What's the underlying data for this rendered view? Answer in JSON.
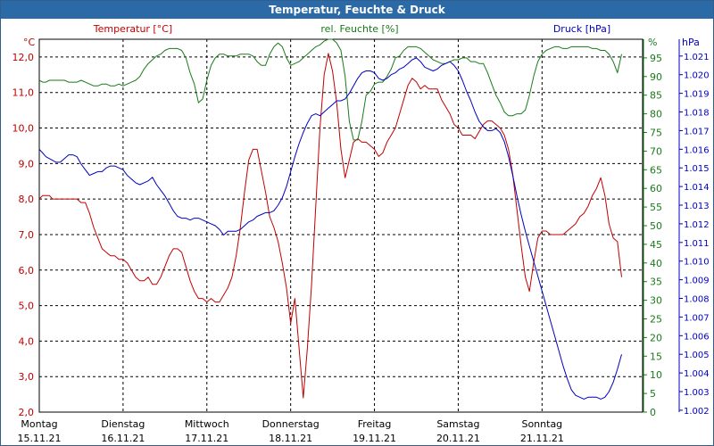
{
  "title": "Temperatur, Feuchte & Druck",
  "chart_data": {
    "type": "line",
    "x_unit": "day",
    "x": [
      0.0,
      0.04,
      0.08,
      0.12,
      0.16,
      0.2,
      0.25,
      0.3,
      0.35,
      0.4,
      0.45,
      0.5,
      0.55,
      0.6,
      0.65,
      0.7,
      0.75,
      0.8,
      0.85,
      0.9,
      0.95,
      1.0,
      1.05,
      1.1,
      1.15,
      1.2,
      1.25,
      1.3,
      1.35,
      1.4,
      1.45,
      1.5,
      1.55,
      1.6,
      1.65,
      1.7,
      1.75,
      1.8,
      1.85,
      1.9,
      1.95,
      2.0,
      2.05,
      2.1,
      2.15,
      2.2,
      2.25,
      2.3,
      2.35,
      2.4,
      2.45,
      2.5,
      2.55,
      2.6,
      2.65,
      2.7,
      2.75,
      2.8,
      2.85,
      2.9,
      2.95,
      3.0,
      3.05,
      3.1,
      3.15,
      3.2,
      3.25,
      3.3,
      3.35,
      3.4,
      3.45,
      3.5,
      3.55,
      3.6,
      3.65,
      3.7,
      3.75,
      3.8,
      3.85,
      3.9,
      3.95,
      4.0,
      4.05,
      4.1,
      4.15,
      4.2,
      4.25,
      4.3,
      4.35,
      4.4,
      4.45,
      4.5,
      4.55,
      4.6,
      4.65,
      4.7,
      4.75,
      4.8,
      4.85,
      4.9,
      4.95,
      5.0,
      5.05,
      5.1,
      5.15,
      5.2,
      5.25,
      5.3,
      5.35,
      5.4,
      5.45,
      5.5,
      5.55,
      5.6,
      5.65,
      5.7,
      5.75,
      5.8,
      5.85,
      5.9,
      5.95,
      6.0,
      6.05,
      6.1,
      6.15,
      6.2,
      6.25,
      6.3,
      6.35,
      6.4,
      6.45,
      6.5,
      6.55,
      6.6,
      6.65,
      6.7,
      6.75,
      6.8,
      6.85,
      6.9,
      6.95
    ],
    "x_ticks": [
      {
        "day": 0,
        "label": "Montag",
        "date": "15.11.21"
      },
      {
        "day": 1,
        "label": "Dienstag",
        "date": "16.11.21"
      },
      {
        "day": 2,
        "label": "Mittwoch",
        "date": "17.11.21"
      },
      {
        "day": 3,
        "label": "Donnerstag",
        "date": "18.11.21"
      },
      {
        "day": 4,
        "label": "Freitag",
        "date": "19.11.21"
      },
      {
        "day": 5,
        "label": "Samstag",
        "date": "20.11.21"
      },
      {
        "day": 6,
        "label": "Sonntag",
        "date": "21.11.21"
      }
    ],
    "xlim": [
      0,
      7.2
    ],
    "grid": true,
    "axes": [
      {
        "id": "temp",
        "label": "Temperatur [°C]",
        "unit": "°C",
        "color": "#c00000",
        "side": "left",
        "ylim": [
          2.0,
          12.5
        ],
        "ticks": [
          "2,0",
          "3,0",
          "4,0",
          "5,0",
          "6,0",
          "7,0",
          "8,0",
          "9,0",
          "10,0",
          "11,0",
          "12,0"
        ],
        "tick_start": 2,
        "tick_step": 1
      },
      {
        "id": "hum",
        "label": "rel. Feuchte [%]",
        "unit": "%",
        "color": "#1a7a1a",
        "side": "right",
        "ylim": [
          0,
          100
        ],
        "ticks": [
          "0",
          "5",
          "10",
          "15",
          "20",
          "25",
          "30",
          "35",
          "40",
          "45",
          "50",
          "55",
          "60",
          "65",
          "70",
          "75",
          "80",
          "85",
          "90",
          "95"
        ],
        "tick_start": 0,
        "tick_step": 5
      },
      {
        "id": "press",
        "label": "Druck [hPa]",
        "unit": "hPa",
        "color": "#0000c0",
        "side": "right",
        "ylim": [
          1001.9,
          1021.9
        ],
        "ticks": [
          "1.002",
          "1.003",
          "1.004",
          "1.005",
          "1.006",
          "1.007",
          "1.008",
          "1.009",
          "1.010",
          "1.011",
          "1.012",
          "1.013",
          "1.014",
          "1.015",
          "1.016",
          "1.017",
          "1.018",
          "1.019",
          "1.020",
          "1.021"
        ],
        "tick_start": 1002,
        "tick_step": 1
      }
    ],
    "series": [
      {
        "axis": "temp",
        "color": "#c00000",
        "values": [
          8.0,
          8.1,
          8.1,
          8.1,
          8.0,
          8.0,
          8.0,
          8.0,
          8.0,
          8.0,
          8.0,
          7.9,
          7.9,
          7.6,
          7.2,
          6.9,
          6.6,
          6.5,
          6.4,
          6.4,
          6.3,
          6.3,
          6.2,
          6.0,
          5.8,
          5.7,
          5.7,
          5.8,
          5.6,
          5.6,
          5.8,
          6.1,
          6.4,
          6.6,
          6.6,
          6.5,
          6.1,
          5.7,
          5.4,
          5.2,
          5.2,
          5.1,
          5.2,
          5.1,
          5.1,
          5.3,
          5.5,
          5.8,
          6.4,
          7.2,
          8.2,
          9.1,
          9.4,
          9.4,
          8.8,
          8.2,
          7.5,
          7.2,
          6.8,
          6.2,
          5.5,
          4.5,
          5.2,
          3.8,
          2.4,
          3.8,
          5.6,
          7.8,
          10.0,
          11.5,
          12.1,
          11.6,
          10.7,
          9.4,
          8.6,
          9.1,
          9.6,
          9.7,
          9.6,
          9.6,
          9.5,
          9.4,
          9.2,
          9.3,
          9.6,
          9.8,
          10.0,
          10.4,
          10.8,
          11.2,
          11.4,
          11.3,
          11.1,
          11.2,
          11.1,
          11.1,
          11.1,
          10.8,
          10.6,
          10.4,
          10.1,
          10.0,
          9.8,
          9.8,
          9.8,
          9.7,
          9.9,
          10.1,
          10.2,
          10.2,
          10.1,
          10.0,
          9.8,
          9.4,
          8.7,
          7.7,
          6.7,
          5.8,
          5.4,
          6.2,
          6.9,
          7.1,
          7.1,
          7.0,
          7.0,
          7.0,
          7.0,
          7.1,
          7.2,
          7.3,
          7.5,
          7.6,
          7.8,
          8.1,
          8.3,
          8.6,
          8.1,
          7.3,
          6.9,
          6.8,
          5.8,
          4.7,
          3.9
        ]
      },
      {
        "axis": "hum",
        "color": "#1a7a1a",
        "values": [
          89,
          88.5,
          88.5,
          89,
          89,
          89,
          89,
          89,
          88.5,
          88.5,
          88.5,
          89,
          88.5,
          88,
          87.5,
          87.5,
          88,
          88,
          87.5,
          87.5,
          88,
          87.5,
          88,
          88.5,
          89,
          90,
          92,
          93.5,
          94.5,
          95.5,
          96,
          97,
          97.5,
          97.5,
          97.5,
          97,
          95,
          91,
          88,
          83,
          84,
          89,
          93,
          95,
          96,
          96,
          95.5,
          95.5,
          95.5,
          96,
          96,
          96,
          95.5,
          94,
          93,
          93,
          96,
          98,
          99,
          98,
          95,
          93,
          93.5,
          94,
          95,
          96,
          97,
          98,
          98.5,
          99.5,
          100,
          100,
          99,
          97,
          90,
          78,
          73,
          73,
          78,
          85,
          86,
          88,
          88.5,
          88.5,
          90,
          92,
          95,
          95.5,
          97,
          98,
          98,
          98,
          97.5,
          96.5,
          95.5,
          94.5,
          94,
          93.5,
          93.5,
          94,
          94.5,
          94.5,
          95,
          95,
          94,
          94,
          93.5,
          93.5,
          91,
          88,
          85,
          83,
          80.5,
          79.5,
          79.5,
          80,
          80,
          81,
          85,
          90,
          94,
          96,
          97,
          97.5,
          98,
          98,
          97.5,
          97.5,
          98,
          98,
          98,
          98,
          98,
          97.5,
          97.5,
          97,
          97,
          96,
          94,
          91,
          96,
          98,
          99
        ]
      },
      {
        "axis": "press",
        "color": "#0000c0",
        "values": [
          1016.0,
          1015.8,
          1015.6,
          1015.5,
          1015.4,
          1015.3,
          1015.3,
          1015.5,
          1015.7,
          1015.7,
          1015.6,
          1015.2,
          1014.9,
          1014.6,
          1014.7,
          1014.8,
          1014.8,
          1015.0,
          1015.1,
          1015.1,
          1015.0,
          1014.9,
          1014.6,
          1014.4,
          1014.2,
          1014.1,
          1014.2,
          1014.3,
          1014.5,
          1014.1,
          1013.8,
          1013.5,
          1013.1,
          1012.7,
          1012.4,
          1012.3,
          1012.3,
          1012.2,
          1012.3,
          1012.3,
          1012.2,
          1012.1,
          1012.0,
          1011.9,
          1011.7,
          1011.4,
          1011.6,
          1011.6,
          1011.6,
          1011.7,
          1011.9,
          1012.1,
          1012.2,
          1012.4,
          1012.5,
          1012.6,
          1012.6,
          1012.7,
          1013.0,
          1013.4,
          1014.0,
          1014.8,
          1015.6,
          1016.3,
          1016.9,
          1017.4,
          1017.8,
          1017.9,
          1017.8,
          1018.0,
          1018.2,
          1018.4,
          1018.6,
          1018.6,
          1018.7,
          1019.0,
          1019.4,
          1019.8,
          1020.1,
          1020.2,
          1020.2,
          1020.1,
          1019.8,
          1019.7,
          1019.8,
          1020.0,
          1020.1,
          1020.3,
          1020.4,
          1020.6,
          1020.8,
          1020.9,
          1020.7,
          1020.4,
          1020.3,
          1020.2,
          1020.3,
          1020.5,
          1020.6,
          1020.7,
          1020.5,
          1020.2,
          1019.7,
          1019.1,
          1018.6,
          1018.0,
          1017.5,
          1017.2,
          1017.0,
          1017.0,
          1017.1,
          1016.9,
          1016.4,
          1015.6,
          1014.6,
          1013.5,
          1012.5,
          1011.6,
          1010.8,
          1010.0,
          1009.2,
          1008.4,
          1007.6,
          1006.8,
          1006.0,
          1005.2,
          1004.4,
          1003.7,
          1003.1,
          1002.8,
          1002.7,
          1002.6,
          1002.7,
          1002.7,
          1002.7,
          1002.6,
          1002.7,
          1003.0,
          1003.5,
          1004.2,
          1005.0,
          1005.8,
          1006.6,
          1007.2
        ]
      }
    ]
  }
}
